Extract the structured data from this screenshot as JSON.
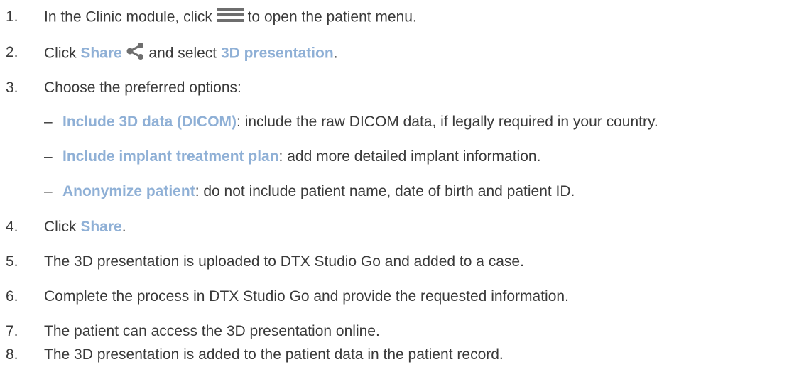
{
  "steps": [
    {
      "num": "1.",
      "before": "In the Clinic module, click ",
      "icon": "hamburger-menu-icon",
      "after": " to open the patient menu."
    },
    {
      "num": "2.",
      "t1": "Click ",
      "hl1": "Share",
      "icon": "share-icon",
      "t2": " and select ",
      "hl2": "3D presentation",
      "t3": "."
    },
    {
      "num": "3.",
      "text": "Choose the preferred options:"
    },
    {
      "num": "4.",
      "t1": "Click ",
      "hl1": "Share",
      "t2": "."
    },
    {
      "num": "5.",
      "text": "The 3D presentation is uploaded to DTX Studio Go and added to a case."
    },
    {
      "num": "6.",
      "text": "Complete the process in DTX Studio Go and provide the requested information."
    },
    {
      "num": "7.",
      "text": "The patient can access the 3D presentation online."
    },
    {
      "num": "8.",
      "text": "The 3D presentation is added to the patient data in the patient record."
    }
  ],
  "options": [
    {
      "dash": "–",
      "label": "Include 3D data (DICOM)",
      "desc": ": include the raw DICOM data, if legally required in your country."
    },
    {
      "dash": "–",
      "label": "Include implant treatment plan",
      "desc": ": add more detailed implant information."
    },
    {
      "dash": "–",
      "label": "Anonymize patient",
      "desc": ": do not include patient name, date of birth and patient ID."
    }
  ],
  "colors": {
    "highlight": "#8fb0d6",
    "text": "#3a3a3a",
    "icon": "#6e6e6e"
  }
}
